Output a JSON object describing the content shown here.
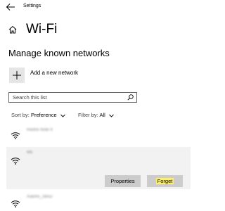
{
  "window": {
    "title": "Settings"
  },
  "header": {
    "title": "Wi-Fi"
  },
  "section": {
    "heading": "Manage known networks"
  },
  "add_network": {
    "label": "Add a new network"
  },
  "search": {
    "placeholder": "Search this list"
  },
  "sort": {
    "label": "Sort by:",
    "value": "Preference"
  },
  "filter": {
    "label": "Filter by:",
    "value": "All"
  },
  "networks": [
    {
      "name": "Redmi Note 9",
      "selected": false
    },
    {
      "name": "Me",
      "selected": true,
      "actions": {
        "properties_label": "Properties",
        "forget_label": "Forget"
      }
    },
    {
      "name": "Xiaomi_2B5D",
      "selected": false
    }
  ],
  "colors": {
    "selected_row": "#f2f2f2",
    "button": "#cccccc",
    "highlight": "#fff06a",
    "icon_box": "#e5e5e5"
  }
}
